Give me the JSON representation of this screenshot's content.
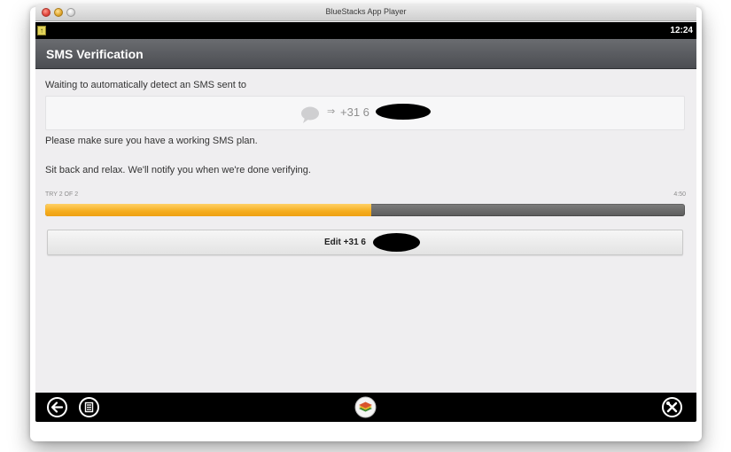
{
  "window": {
    "title": "BlueStacks App Player"
  },
  "statusbar": {
    "notification_icon": "notification-icon",
    "time": "12:24"
  },
  "header": {
    "title": "SMS Verification"
  },
  "content": {
    "waiting_text": "Waiting to automatically detect an SMS sent to",
    "phone_icon": "sms-bubble-icon",
    "arrow": "⇒",
    "phone_number": "+31 6",
    "sms_plan_text": "Please make sure you have a working SMS plan.",
    "relax_text": "Sit back and relax. We'll notify you when we're done verifying.",
    "try_label": "TRY 2 OF 2",
    "timer": "4:50",
    "progress_fraction": 0.51,
    "progress_color": "#f5ad1f",
    "edit_button_label": "Edit +31 6"
  },
  "navbar": {
    "back_icon": "back-icon",
    "menu_icon": "menu-icon",
    "home_icon": "bluestacks-logo-icon",
    "settings_icon": "tools-icon"
  }
}
